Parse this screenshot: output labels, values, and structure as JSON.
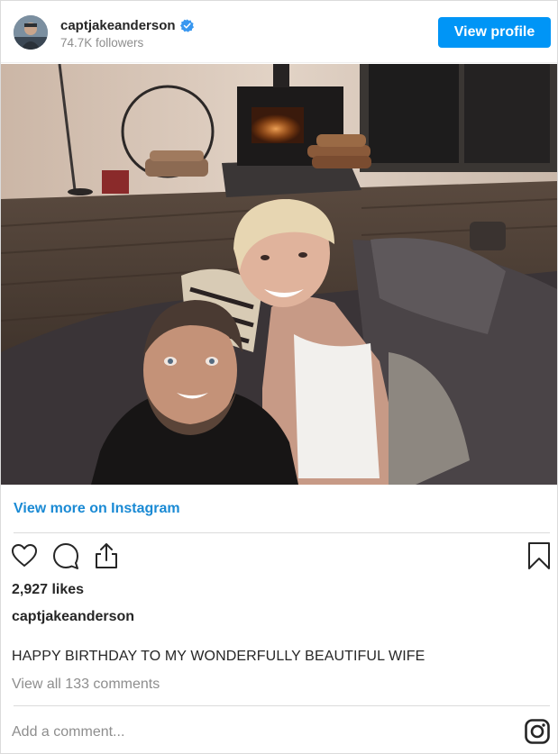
{
  "header": {
    "username": "captjakeanderson",
    "followers": "74.7K followers",
    "view_profile_label": "View profile"
  },
  "view_more_label": "View more on Instagram",
  "likes": "2,927 likes",
  "caption": {
    "username": "captjakeanderson",
    "text": "HAPPY BIRTHDAY TO MY WONDERFULLY BEAUTIFUL WIFE"
  },
  "comments_link": "View all 133 comments",
  "add_comment_placeholder": "Add a comment...",
  "colors": {
    "accent": "#0095f6",
    "link": "#1a8ad4",
    "muted": "#8e8e8e",
    "text": "#262626"
  },
  "icons": [
    "verified-badge-icon",
    "heart-icon",
    "comment-icon",
    "share-icon",
    "bookmark-icon",
    "instagram-icon"
  ]
}
